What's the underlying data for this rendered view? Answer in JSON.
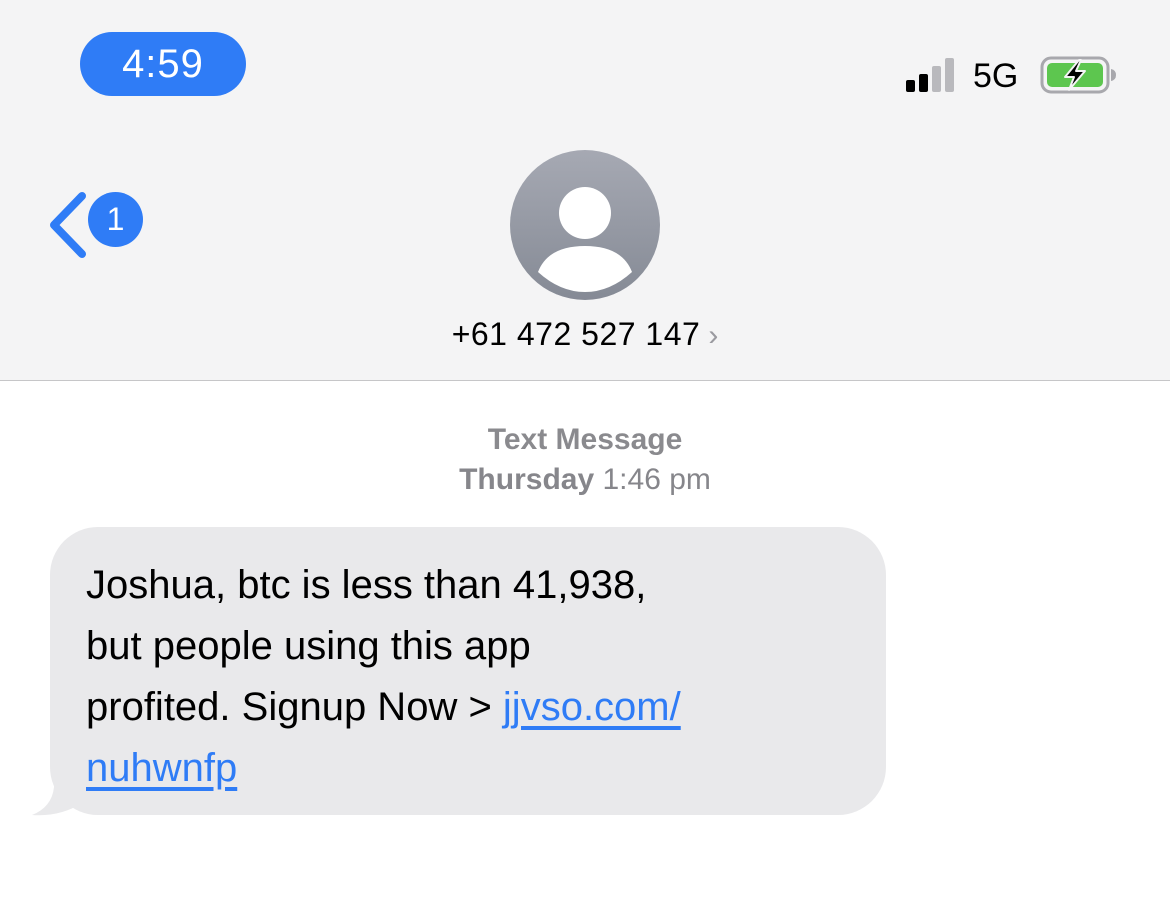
{
  "status_bar": {
    "time": "4:59",
    "network": "5G",
    "signal_bars_active": 2,
    "signal_bars_total": 4,
    "battery_charging": true,
    "battery_level": 0.75,
    "accent_color": "#2f7cf6"
  },
  "nav": {
    "back_badge_count": "1",
    "back_icon": "chevron-left-icon"
  },
  "contact": {
    "avatar_icon": "person-placeholder-icon",
    "number": "+61 472 527 147",
    "chevron": "›"
  },
  "thread": {
    "label": "Text Message",
    "day": "Thursday",
    "time": "1:46 pm"
  },
  "message": {
    "text": "Joshua, btc is less than 41,938, but people using this app profited. Signup Now > ",
    "link_text": "jjvso.com/nuhwnfp",
    "link_line1": "jjvso.com/",
    "link_line2": "nuhwnfp",
    "line1": "Joshua, btc is less than 41,938,",
    "line2": "but people using this app",
    "line3_prefix": "profited. Signup Now > ",
    "bubble_color": "#e9e9eb",
    "link_color": "#2f7cf6"
  }
}
